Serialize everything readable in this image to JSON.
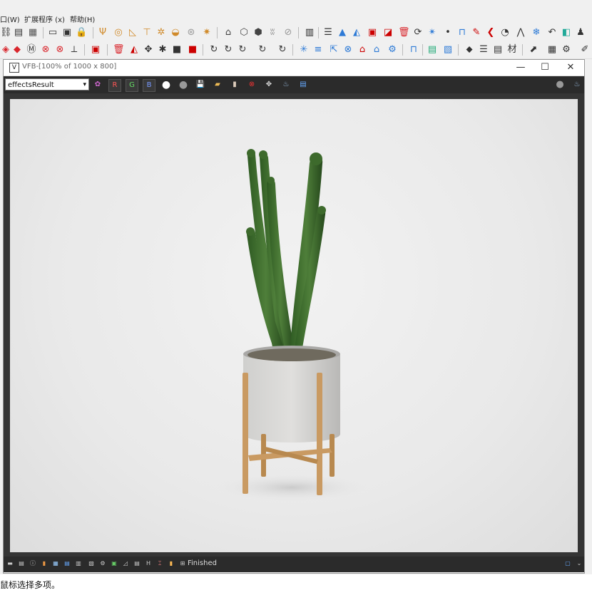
{
  "menu": {
    "window": "口(W)",
    "extensions": "扩展程序 (x)",
    "help": "帮助(H)"
  },
  "vfb": {
    "title": "VFB-[100% of 1000 x 800]",
    "channel_select": "effectsResult",
    "buttons": {
      "r": "R",
      "g": "G",
      "b": "B"
    },
    "status": "Finished",
    "window_controls": {
      "minimize": "—",
      "maximize": "☐",
      "close": "✕"
    }
  },
  "statusbar": {
    "prompt": "鼠标选择多项。"
  },
  "colors": {
    "toolbar_bg": "#f0f0f0",
    "vfb_dark": "#2b2b2b",
    "canvas_bg": "#ebebeb",
    "red_icon": "#d9262c",
    "blue_icon": "#2d7ad6"
  },
  "scene": {
    "description_icons": "cactus-plant-render"
  }
}
